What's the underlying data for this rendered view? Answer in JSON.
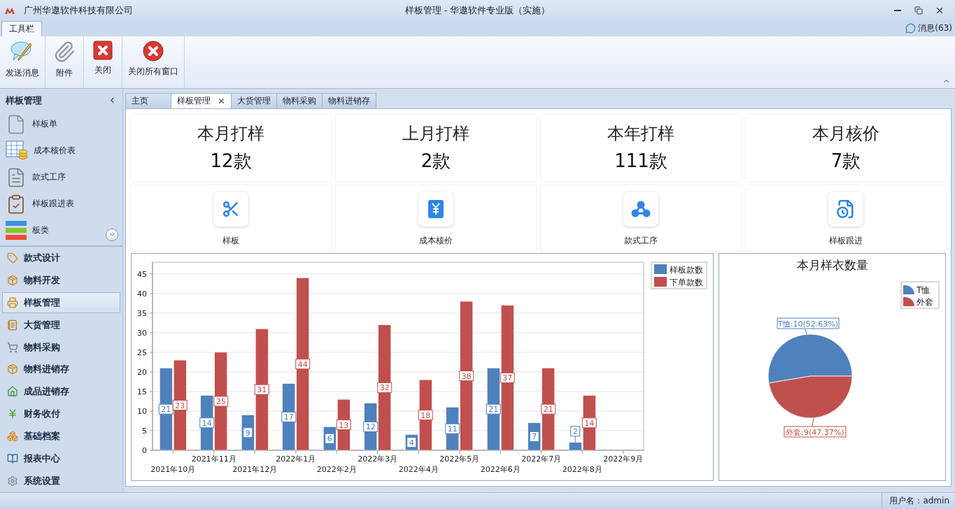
{
  "title_bar": {
    "company": "广州华遨软件科技有限公司",
    "title": "样板管理 - 华遨软件专业版（实施）"
  },
  "ribbon": {
    "tabs": [
      {
        "label": "工具栏",
        "selected": true
      }
    ],
    "messages": "消息(63)",
    "buttons": [
      {
        "label": "发送消息",
        "kind": "message"
      },
      {
        "label": "附件",
        "kind": "attach"
      },
      {
        "label": "关闭",
        "kind": "close"
      },
      {
        "label": "关闭所有窗口",
        "kind": "close_all"
      }
    ]
  },
  "sidebar": {
    "title": "样板管理",
    "items": [
      {
        "label": "样板单",
        "kind": "page"
      },
      {
        "label": "成本核价表",
        "kind": "sheet"
      },
      {
        "label": "款式工序",
        "kind": "document"
      },
      {
        "label": "样板跟进表",
        "kind": "clipboard"
      },
      {
        "label": "板类",
        "kind": "layers"
      }
    ],
    "nav": [
      {
        "label": "款式设计",
        "kind": "tag",
        "selected": false
      },
      {
        "label": "物料开发",
        "kind": "boxes",
        "selected": false
      },
      {
        "label": "样板管理",
        "kind": "printer",
        "selected": true
      },
      {
        "label": "大货管理",
        "kind": "notebook",
        "selected": false
      },
      {
        "label": "物料采购",
        "kind": "cart",
        "selected": false
      },
      {
        "label": "物料进销存",
        "kind": "boxes",
        "selected": false
      },
      {
        "label": "成品进销存",
        "kind": "house",
        "selected": false
      },
      {
        "label": "财务收付",
        "kind": "yen",
        "selected": false
      },
      {
        "label": "基础档案",
        "kind": "stack",
        "selected": false
      },
      {
        "label": "报表中心",
        "kind": "book",
        "selected": false
      },
      {
        "label": "系统设置",
        "kind": "gear",
        "selected": false
      }
    ]
  },
  "tabs": [
    {
      "label": "主页",
      "selected": false,
      "closable": false
    },
    {
      "label": "样板管理",
      "selected": true,
      "closable": true
    },
    {
      "label": "大货管理",
      "selected": false,
      "closable": false
    },
    {
      "label": "物料采购",
      "selected": false,
      "closable": false
    },
    {
      "label": "物料进销存",
      "selected": false,
      "closable": false
    }
  ],
  "stats": [
    {
      "title": "本月打样",
      "value": "12款"
    },
    {
      "title": "上月打样",
      "value": "2款"
    },
    {
      "title": "本年打样",
      "value": "111款"
    },
    {
      "title": "本月核价",
      "value": "7款"
    }
  ],
  "shortcuts": [
    {
      "label": "样板",
      "kind": "scissors"
    },
    {
      "label": "成本核价",
      "kind": "yen"
    },
    {
      "label": "款式工序",
      "kind": "nodes"
    },
    {
      "label": "样板跟进",
      "kind": "doc_clock"
    }
  ],
  "bar_chart": {
    "chart_data": {
      "type": "bar",
      "categories": [
        "2021年10月",
        "2021年11月",
        "2021年12月",
        "2022年1月",
        "2022年2月",
        "2022年3月",
        "2022年4月",
        "2022年5月",
        "2022年6月",
        "2022年7月",
        "2022年8月",
        "2022年9月"
      ],
      "series": [
        {
          "name": "样板款数",
          "color": "#4f81bd",
          "values": [
            21,
            14,
            9,
            17,
            6,
            12,
            4,
            11,
            21,
            7,
            2,
            null
          ]
        },
        {
          "name": "下单款数",
          "color": "#c0504d",
          "values": [
            23,
            25,
            31,
            44,
            13,
            32,
            18,
            38,
            37,
            21,
            14,
            null
          ]
        }
      ],
      "ylim": [
        0,
        48
      ],
      "yticks": [
        0,
        5,
        10,
        15,
        20,
        25,
        30,
        35,
        40,
        45
      ],
      "data_labels": true,
      "grid": true,
      "legend": "top-right"
    }
  },
  "pie_chart": {
    "chart_data": {
      "type": "pie",
      "title": "本月样衣数量",
      "categories": [
        "T恤",
        "外套"
      ],
      "values": [
        10,
        9
      ],
      "legend": "top-right",
      "value_labels": [
        "T恤:10(52.63%)",
        "外套:9(47.37%)"
      ]
    }
  },
  "status_bar": {
    "user": "用户名：admin"
  }
}
